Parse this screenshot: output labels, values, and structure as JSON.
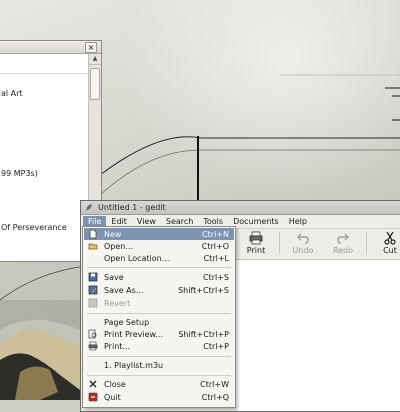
{
  "background_window": {
    "rows": [
      "al Art",
      "99 MP3s)",
      "Of Perseverance"
    ]
  },
  "gedit": {
    "title": "Untitled 1 - gedit",
    "menubar": [
      "File",
      "Edit",
      "View",
      "Search",
      "Tools",
      "Documents",
      "Help"
    ],
    "toolbar": {
      "print": "Print",
      "undo": "Undo",
      "redo": "Redo",
      "cut": "Cut"
    }
  },
  "file_menu": {
    "items": [
      {
        "label": "New",
        "accel": "Ctrl+N",
        "icon": "new-document-icon"
      },
      {
        "label": "Open...",
        "accel": "Ctrl+O",
        "icon": "open-folder-icon"
      },
      {
        "label": "Open Location...",
        "accel": "Ctrl+L",
        "icon": ""
      },
      {
        "label": "Save",
        "accel": "Ctrl+S",
        "icon": "save-icon"
      },
      {
        "label": "Save As...",
        "accel": "Shift+Ctrl+S",
        "icon": "save-as-icon"
      },
      {
        "label": "Revert",
        "accel": "",
        "icon": "revert-icon"
      },
      {
        "label": "Page Setup",
        "accel": "",
        "icon": ""
      },
      {
        "label": "Print Preview...",
        "accel": "Shift+Ctrl+P",
        "icon": "print-preview-icon"
      },
      {
        "label": "Print...",
        "accel": "Ctrl+P",
        "icon": "print-icon"
      },
      {
        "label": "1. Playlist.m3u",
        "accel": "",
        "icon": ""
      },
      {
        "label": "Close",
        "accel": "Ctrl+W",
        "icon": "close-icon"
      },
      {
        "label": "Quit",
        "accel": "Ctrl+Q",
        "icon": "quit-icon"
      }
    ]
  }
}
